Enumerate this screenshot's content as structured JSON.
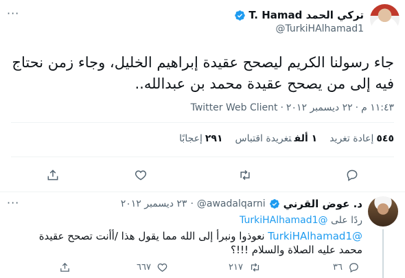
{
  "tweet": {
    "author_name": "تركي الحمد T. Hamad",
    "handle": "@TurkiHAlhamad1",
    "text": "جاء رسولنا الكريم ليصحح عقيدة إبراهيم الخليل، وجاء زمن نحتاج فيه إلى من يصحح عقيدة محمد بن عبدالله..",
    "time": "١١:٤٣ م",
    "date": "٢٢ ديسمبر ٢٠١٢",
    "dot": "·",
    "client": "Twitter Web Client",
    "stats": {
      "retweets_count": "٥٤٥",
      "retweets_label": "إعادة تغريد",
      "quotes_count": "١ ألف",
      "quotes_label": "تغريدة اقتباس",
      "likes_count": "٢٩١",
      "likes_label": "إعجابًا"
    },
    "more": "···"
  },
  "reply": {
    "author_name": "د. عوض القرني",
    "handle": "@awadalqarni",
    "dot": "·",
    "date": "٢٣ ديسمبر ٢٠١٢",
    "replying_prefix": "ردًا على",
    "replying_to": "@TurkiHAlhamad1",
    "mention": "@TurkiHAlhamad1",
    "text": " نعوذوا ونبرأ إلى الله مما يقول هذا /أأنت تصحح عقيدة محمد عليه الصلاة والسلام !!!؟",
    "reply_count": "٣٦",
    "retweet_count": "٢١٧",
    "like_count": "٦٦٧",
    "more": "···"
  },
  "colors": {
    "accent": "#1d9bf0",
    "secondary_text": "#536471",
    "divider": "#eff3f4"
  },
  "icons": [
    "verified-badge-icon",
    "reply-icon",
    "retweet-icon",
    "like-icon",
    "share-icon",
    "more-icon"
  ]
}
